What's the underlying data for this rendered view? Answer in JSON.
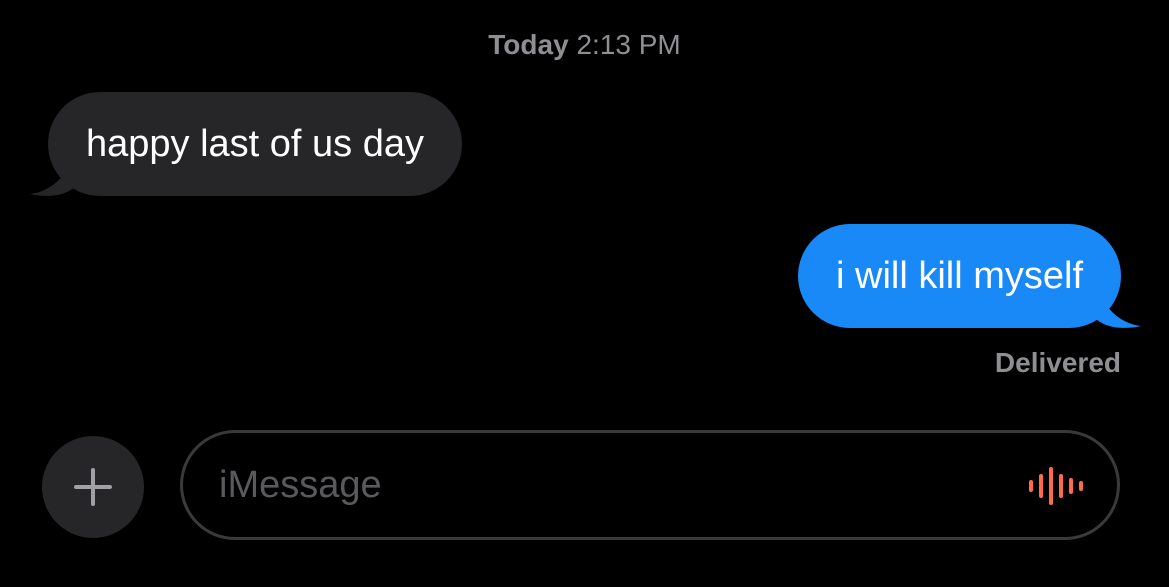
{
  "header": {
    "day": "Today",
    "time": "2:13 PM"
  },
  "messages": [
    {
      "direction": "received",
      "text": "happy last of us day"
    },
    {
      "direction": "sent",
      "text": "i will kill myself"
    }
  ],
  "status": {
    "delivered": "Delivered"
  },
  "composer": {
    "placeholder": "iMessage",
    "value": "",
    "plus_icon": "plus-icon",
    "audio_icon": "audio-waveform-icon"
  },
  "colors": {
    "background": "#000000",
    "received_bubble": "#262628",
    "sent_bubble": "#1a89f8",
    "meta_text": "#8e8e93",
    "audio_icon": "#ff6a4d"
  }
}
